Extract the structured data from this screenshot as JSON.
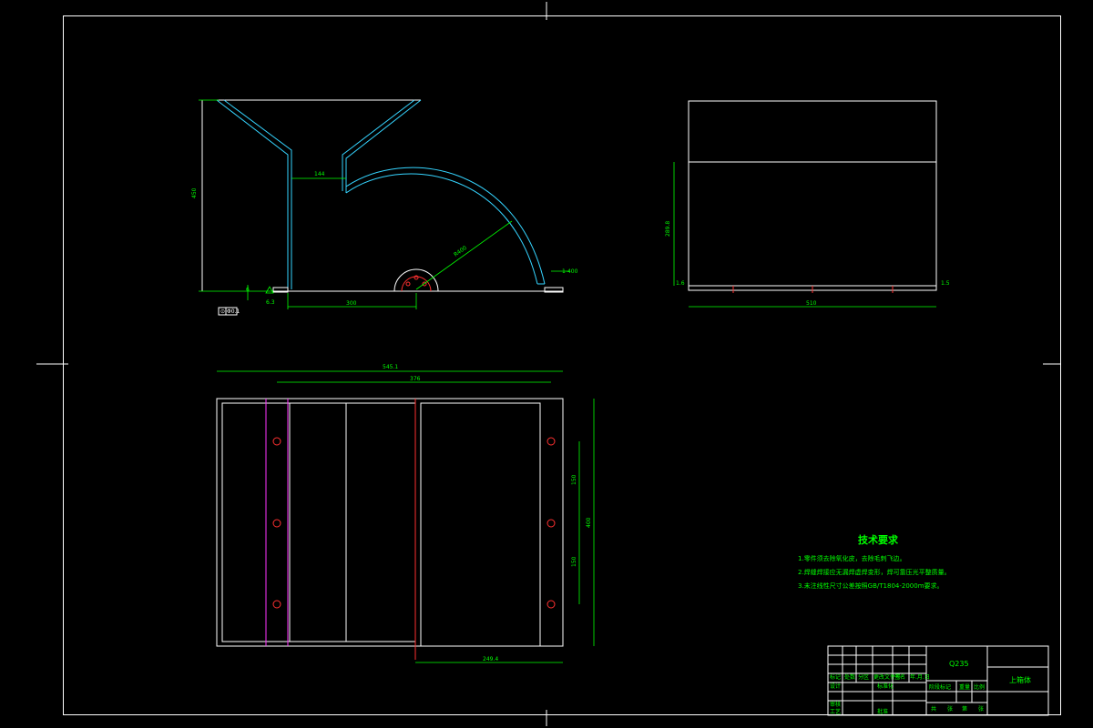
{
  "drawing": {
    "background": "#000000",
    "colors": {
      "outline": "#ffffff",
      "dimension": "#00ff00",
      "section": "#35d4ff",
      "holes": "#ff3030",
      "flange": "#ff33ff"
    }
  },
  "front_view": {
    "dims": {
      "throat_width": "144",
      "height": "450",
      "base_length": "300",
      "arc_radius": "R400",
      "weld_note": "6",
      "right_note": "1-400",
      "tol_box_a": "⊙",
      "tol_box_b": "Φ0.1"
    }
  },
  "side_view": {
    "dims": {
      "height": "289.8",
      "width": "510",
      "left_small": "1.6",
      "right_small": "1.5"
    }
  },
  "plan_view": {
    "dims": {
      "overall": "545.1",
      "hole_span": "376",
      "bottom": "249.4",
      "right_total": "400",
      "pitch_top": "150",
      "pitch_bottom": "150"
    }
  },
  "tech_notes": {
    "title": "技术要求",
    "lines": [
      "1.零件须去除氧化皮，去除毛刺飞边。",
      "2.焊缝焊接应无漏焊虚焊变形，焊可靠压光平整质量。",
      "3.未注线性尺寸公差按照GB/T1804-2000m要求。"
    ]
  },
  "title_block": {
    "material": "Q235",
    "part_name": "上箱体",
    "labels": [
      "标记",
      "处数",
      "分区",
      "更改文件号",
      "签名",
      "年.月.日",
      "设计",
      "标准化",
      "审核",
      "工艺",
      "批准"
    ],
    "stage_labels": [
      "阶段标记",
      "重量",
      "比例"
    ],
    "sheet_labels": [
      "共",
      "张",
      "第",
      "张"
    ]
  }
}
